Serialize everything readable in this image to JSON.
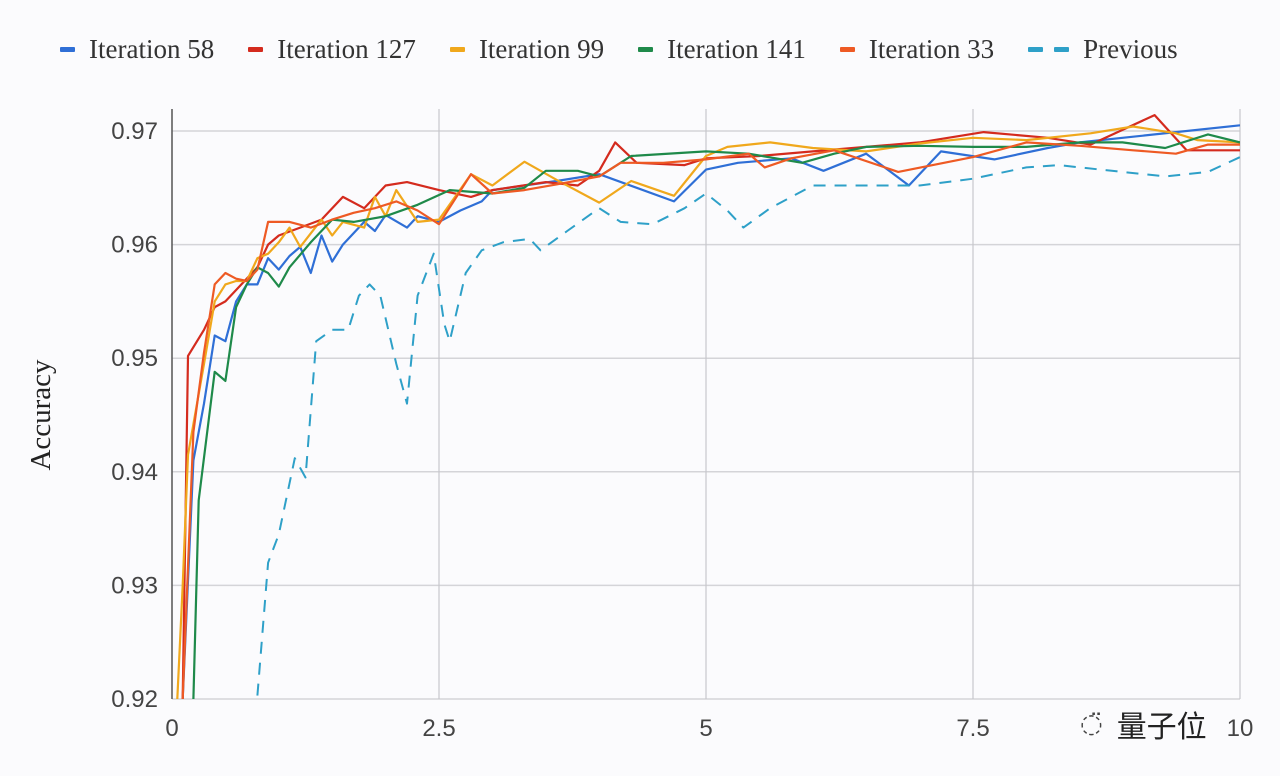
{
  "chart_data": {
    "type": "line",
    "title": "",
    "xlabel": "",
    "ylabel": "Accuracy",
    "xlim": [
      0,
      10
    ],
    "ylim": [
      0.92,
      0.97
    ],
    "x_ticks": [
      "0",
      "2.5",
      "5",
      "7.5",
      "10"
    ],
    "x_tick_values": [
      0,
      2.5,
      5,
      7.5,
      10
    ],
    "y_ticks": [
      "0.92",
      "0.93",
      "0.94",
      "0.95",
      "0.96",
      "0.97"
    ],
    "y_tick_values": [
      0.92,
      0.93,
      0.94,
      0.95,
      0.96,
      0.97
    ],
    "grid": true,
    "legend_position": "top",
    "series": [
      {
        "name": "Iteration 58",
        "color": "#2f6fd6",
        "dashed": false,
        "points": [
          [
            0.1,
            0.92
          ],
          [
            0.2,
            0.941
          ],
          [
            0.3,
            0.946
          ],
          [
            0.4,
            0.952
          ],
          [
            0.5,
            0.9515
          ],
          [
            0.6,
            0.955
          ],
          [
            0.7,
            0.9565
          ],
          [
            0.8,
            0.9565
          ],
          [
            0.9,
            0.9588
          ],
          [
            1.0,
            0.9578
          ],
          [
            1.1,
            0.959
          ],
          [
            1.2,
            0.9598
          ],
          [
            1.3,
            0.9575
          ],
          [
            1.4,
            0.9608
          ],
          [
            1.5,
            0.9585
          ],
          [
            1.6,
            0.96
          ],
          [
            1.8,
            0.962
          ],
          [
            1.9,
            0.9612
          ],
          [
            2.0,
            0.9626
          ],
          [
            2.2,
            0.9615
          ],
          [
            2.3,
            0.9625
          ],
          [
            2.5,
            0.962
          ],
          [
            2.7,
            0.963
          ],
          [
            2.9,
            0.9638
          ],
          [
            3.0,
            0.9648
          ],
          [
            3.3,
            0.9652
          ],
          [
            3.6,
            0.9656
          ],
          [
            4.0,
            0.9662
          ],
          [
            4.7,
            0.9638
          ],
          [
            5.0,
            0.9666
          ],
          [
            5.3,
            0.9672
          ],
          [
            5.8,
            0.9676
          ],
          [
            6.1,
            0.9665
          ],
          [
            6.5,
            0.968
          ],
          [
            6.9,
            0.9652
          ],
          [
            7.2,
            0.9682
          ],
          [
            7.7,
            0.9675
          ],
          [
            8.2,
            0.9685
          ],
          [
            8.5,
            0.969
          ],
          [
            9.0,
            0.9695
          ],
          [
            10.0,
            0.9705
          ]
        ]
      },
      {
        "name": "Iteration 127",
        "color": "#d42b1e",
        "dashed": false,
        "points": [
          [
            0.1,
            0.92
          ],
          [
            0.15,
            0.9502
          ],
          [
            0.3,
            0.9525
          ],
          [
            0.4,
            0.9545
          ],
          [
            0.5,
            0.955
          ],
          [
            0.6,
            0.956
          ],
          [
            0.8,
            0.958
          ],
          [
            0.9,
            0.96
          ],
          [
            1.0,
            0.9608
          ],
          [
            1.2,
            0.9615
          ],
          [
            1.4,
            0.9622
          ],
          [
            1.6,
            0.9642
          ],
          [
            1.8,
            0.9632
          ],
          [
            2.0,
            0.9652
          ],
          [
            2.2,
            0.9655
          ],
          [
            2.5,
            0.9648
          ],
          [
            2.8,
            0.9642
          ],
          [
            3.0,
            0.9648
          ],
          [
            3.5,
            0.9655
          ],
          [
            3.8,
            0.9652
          ],
          [
            4.0,
            0.9665
          ],
          [
            4.15,
            0.969
          ],
          [
            4.35,
            0.9672
          ],
          [
            4.8,
            0.967
          ],
          [
            5.0,
            0.9676
          ],
          [
            5.5,
            0.9678
          ],
          [
            6.0,
            0.9682
          ],
          [
            6.5,
            0.9686
          ],
          [
            7.0,
            0.969
          ],
          [
            7.6,
            0.9699
          ],
          [
            8.2,
            0.9694
          ],
          [
            8.6,
            0.9688
          ],
          [
            8.9,
            0.9701
          ],
          [
            9.2,
            0.9714
          ],
          [
            9.5,
            0.9683
          ],
          [
            10.0,
            0.9683
          ]
        ]
      },
      {
        "name": "Iteration 99",
        "color": "#f0a81c",
        "dashed": false,
        "points": [
          [
            0.05,
            0.92
          ],
          [
            0.1,
            0.93
          ],
          [
            0.15,
            0.9415
          ],
          [
            0.3,
            0.9495
          ],
          [
            0.4,
            0.955
          ],
          [
            0.5,
            0.9565
          ],
          [
            0.6,
            0.9568
          ],
          [
            0.7,
            0.9568
          ],
          [
            0.8,
            0.9588
          ],
          [
            0.9,
            0.9592
          ],
          [
            1.0,
            0.9602
          ],
          [
            1.1,
            0.9615
          ],
          [
            1.2,
            0.9598
          ],
          [
            1.4,
            0.9622
          ],
          [
            1.5,
            0.9608
          ],
          [
            1.6,
            0.962
          ],
          [
            1.8,
            0.9615
          ],
          [
            1.9,
            0.9642
          ],
          [
            2.0,
            0.9625
          ],
          [
            2.1,
            0.9648
          ],
          [
            2.3,
            0.962
          ],
          [
            2.5,
            0.9622
          ],
          [
            2.8,
            0.9662
          ],
          [
            3.0,
            0.9652
          ],
          [
            3.3,
            0.9673
          ],
          [
            3.6,
            0.9657
          ],
          [
            4.0,
            0.9637
          ],
          [
            4.3,
            0.9656
          ],
          [
            4.7,
            0.9643
          ],
          [
            5.0,
            0.9678
          ],
          [
            5.2,
            0.9686
          ],
          [
            5.6,
            0.969
          ],
          [
            6.0,
            0.9685
          ],
          [
            6.5,
            0.9682
          ],
          [
            7.0,
            0.9689
          ],
          [
            7.5,
            0.9694
          ],
          [
            8.0,
            0.9692
          ],
          [
            8.6,
            0.9698
          ],
          [
            9.0,
            0.9704
          ],
          [
            9.4,
            0.9698
          ],
          [
            9.6,
            0.9692
          ],
          [
            10.0,
            0.969
          ]
        ]
      },
      {
        "name": "Iteration 141",
        "color": "#1f8a4a",
        "dashed": false,
        "points": [
          [
            0.2,
            0.92
          ],
          [
            0.25,
            0.9375
          ],
          [
            0.4,
            0.9488
          ],
          [
            0.5,
            0.948
          ],
          [
            0.6,
            0.9545
          ],
          [
            0.7,
            0.9565
          ],
          [
            0.8,
            0.958
          ],
          [
            0.9,
            0.9575
          ],
          [
            1.0,
            0.9563
          ],
          [
            1.1,
            0.958
          ],
          [
            1.3,
            0.9602
          ],
          [
            1.5,
            0.9622
          ],
          [
            1.7,
            0.962
          ],
          [
            2.0,
            0.9625
          ],
          [
            2.3,
            0.9635
          ],
          [
            2.6,
            0.9648
          ],
          [
            3.0,
            0.9645
          ],
          [
            3.3,
            0.965
          ],
          [
            3.5,
            0.9665
          ],
          [
            3.8,
            0.9665
          ],
          [
            4.0,
            0.966
          ],
          [
            4.3,
            0.9678
          ],
          [
            5.0,
            0.9682
          ],
          [
            5.4,
            0.968
          ],
          [
            5.9,
            0.9672
          ],
          [
            6.2,
            0.968
          ],
          [
            6.5,
            0.9686
          ],
          [
            7.0,
            0.9687
          ],
          [
            7.5,
            0.9686
          ],
          [
            8.0,
            0.9686
          ],
          [
            8.5,
            0.969
          ],
          [
            8.9,
            0.969
          ],
          [
            9.3,
            0.9685
          ],
          [
            9.7,
            0.9697
          ],
          [
            10.0,
            0.969
          ]
        ]
      },
      {
        "name": "Iteration 33",
        "color": "#ee5a24",
        "dashed": false,
        "points": [
          [
            0.1,
            0.92
          ],
          [
            0.2,
            0.9435
          ],
          [
            0.3,
            0.9505
          ],
          [
            0.4,
            0.9565
          ],
          [
            0.5,
            0.9575
          ],
          [
            0.6,
            0.957
          ],
          [
            0.7,
            0.9568
          ],
          [
            0.8,
            0.9578
          ],
          [
            0.9,
            0.962
          ],
          [
            1.0,
            0.962
          ],
          [
            1.1,
            0.962
          ],
          [
            1.3,
            0.9615
          ],
          [
            1.5,
            0.9622
          ],
          [
            1.7,
            0.9628
          ],
          [
            1.9,
            0.9632
          ],
          [
            2.1,
            0.9638
          ],
          [
            2.3,
            0.963
          ],
          [
            2.5,
            0.9618
          ],
          [
            2.8,
            0.9662
          ],
          [
            3.0,
            0.9645
          ],
          [
            3.3,
            0.9648
          ],
          [
            3.6,
            0.9653
          ],
          [
            4.0,
            0.966
          ],
          [
            4.2,
            0.9672
          ],
          [
            4.6,
            0.9672
          ],
          [
            5.0,
            0.9675
          ],
          [
            5.4,
            0.968
          ],
          [
            5.55,
            0.9668
          ],
          [
            5.8,
            0.9676
          ],
          [
            6.2,
            0.9683
          ],
          [
            6.8,
            0.9664
          ],
          [
            7.5,
            0.9677
          ],
          [
            8.0,
            0.969
          ],
          [
            8.5,
            0.9687
          ],
          [
            9.0,
            0.9683
          ],
          [
            9.4,
            0.968
          ],
          [
            9.7,
            0.9688
          ],
          [
            10.0,
            0.9688
          ]
        ]
      },
      {
        "name": "Previous",
        "color": "#2ea0c8",
        "dashed": true,
        "points": [
          [
            0.8,
            0.9203
          ],
          [
            0.9,
            0.932
          ],
          [
            1.0,
            0.9345
          ],
          [
            1.15,
            0.9412
          ],
          [
            1.25,
            0.9395
          ],
          [
            1.35,
            0.9515
          ],
          [
            1.5,
            0.9525
          ],
          [
            1.65,
            0.9525
          ],
          [
            1.75,
            0.9555
          ],
          [
            1.85,
            0.9565
          ],
          [
            1.95,
            0.9555
          ],
          [
            2.1,
            0.9495
          ],
          [
            2.2,
            0.946
          ],
          [
            2.3,
            0.9555
          ],
          [
            2.45,
            0.9592
          ],
          [
            2.55,
            0.953
          ],
          [
            2.6,
            0.9515
          ],
          [
            2.75,
            0.9575
          ],
          [
            2.9,
            0.9595
          ],
          [
            3.1,
            0.9602
          ],
          [
            3.35,
            0.9605
          ],
          [
            3.45,
            0.9595
          ],
          [
            3.7,
            0.9612
          ],
          [
            4.0,
            0.9632
          ],
          [
            4.2,
            0.962
          ],
          [
            4.5,
            0.9618
          ],
          [
            4.8,
            0.9632
          ],
          [
            5.0,
            0.9645
          ],
          [
            5.2,
            0.963
          ],
          [
            5.35,
            0.9615
          ],
          [
            5.6,
            0.9632
          ],
          [
            6.0,
            0.9652
          ],
          [
            6.5,
            0.9652
          ],
          [
            7.0,
            0.9652
          ],
          [
            7.5,
            0.9658
          ],
          [
            8.0,
            0.9668
          ],
          [
            8.3,
            0.967
          ],
          [
            8.8,
            0.9665
          ],
          [
            9.3,
            0.966
          ],
          [
            9.7,
            0.9664
          ],
          [
            10.0,
            0.9677
          ]
        ]
      }
    ]
  },
  "watermark": {
    "icon": "wechat-icon",
    "text": "量子位"
  }
}
